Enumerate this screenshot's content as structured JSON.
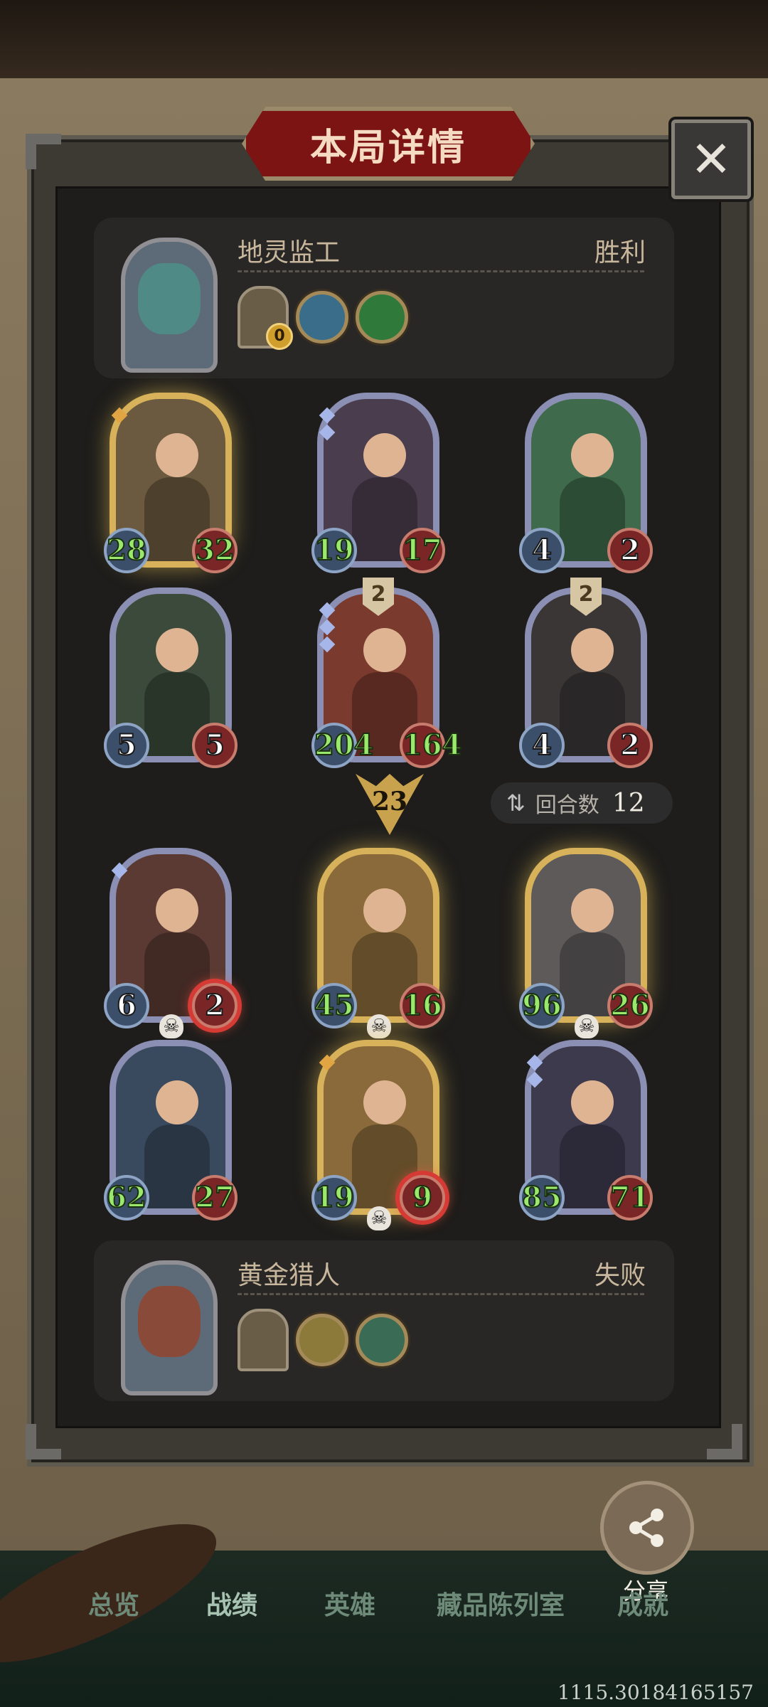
{
  "title": "本局详情",
  "close_symbol": "✕",
  "player_top": {
    "name": "地灵监工",
    "result": "胜利",
    "chest_count": "0",
    "relic_colors": [
      "#3a6d8a",
      "#2f7a3b"
    ]
  },
  "player_bottom": {
    "name": "黄金猎人",
    "result": "失败",
    "relic_colors": [
      "#8c7a3a",
      "#3a6b55"
    ]
  },
  "top_board": [
    {
      "attack": "28",
      "health": "32",
      "rarity": "gold",
      "art": "#6b5a3f",
      "tier": "",
      "stat_color": "green",
      "hit": false,
      "dead": false,
      "gems": 1,
      "gem_color": "gold"
    },
    {
      "attack": "19",
      "health": "17",
      "rarity": "silver",
      "art": "#4a3e4e",
      "tier": "",
      "stat_color": "green",
      "hit": false,
      "dead": false,
      "gems": 2,
      "gem_color": "silver"
    },
    {
      "attack": "4",
      "health": "2",
      "rarity": "silver",
      "art": "#3f6a4c",
      "tier": "",
      "stat_color": "white",
      "hit": false,
      "dead": false,
      "gems": 0,
      "gem_color": "silver"
    },
    {
      "attack": "5",
      "health": "5",
      "rarity": "silver",
      "art": "#3b4a3a",
      "tier": "",
      "stat_color": "white",
      "hit": false,
      "dead": false,
      "gems": 0,
      "gem_color": "silver"
    },
    {
      "attack": "204",
      "health": "164",
      "rarity": "silver",
      "art": "#7b3a2e",
      "tier": "2",
      "stat_color": "green",
      "hit": false,
      "dead": false,
      "gems": 3,
      "gem_color": "silver"
    },
    {
      "attack": "4",
      "health": "2",
      "rarity": "silver",
      "art": "#3a3636",
      "tier": "2",
      "stat_color": "white",
      "hit": false,
      "dead": false,
      "gems": 0,
      "gem_color": "silver"
    }
  ],
  "round_marker": "23",
  "rounds": {
    "icon": "⇅",
    "label": "回合数",
    "value": "12"
  },
  "bottom_board": [
    {
      "attack": "6",
      "health": "2",
      "rarity": "silver",
      "art": "#5a3a32",
      "tier": "",
      "stat_color": "white",
      "hit": true,
      "dead": true,
      "gems": 1,
      "gem_color": "silver"
    },
    {
      "attack": "45",
      "health": "16",
      "rarity": "gold",
      "art": "#8a6a3a",
      "tier": "",
      "stat_color": "green",
      "hit": false,
      "dead": true,
      "gems": 0,
      "gem_color": "silver"
    },
    {
      "attack": "96",
      "health": "26",
      "rarity": "gold",
      "art": "#5e5a5a",
      "tier": "",
      "stat_color": "green",
      "hit": false,
      "dead": true,
      "gems": 0,
      "gem_color": "silver"
    },
    {
      "attack": "62",
      "health": "27",
      "rarity": "silver",
      "art": "#3a4a5e",
      "tier": "",
      "stat_color": "green",
      "hit": false,
      "dead": false,
      "gems": 0,
      "gem_color": "silver"
    },
    {
      "attack": "19",
      "health": "9",
      "rarity": "gold",
      "art": "#8a6a3a",
      "tier": "",
      "stat_color": "green",
      "hit": true,
      "dead": true,
      "gems": 1,
      "gem_color": "gold"
    },
    {
      "attack": "85",
      "health": "71",
      "rarity": "silver",
      "art": "#3e3a4e",
      "tier": "",
      "stat_color": "green",
      "hit": false,
      "dead": false,
      "gems": 2,
      "gem_color": "silver"
    }
  ],
  "share": {
    "icon": "⟨",
    "label": "分享"
  },
  "tabs": [
    "总览",
    "战绩",
    "英雄",
    "藏品陈列室",
    "成就"
  ],
  "active_tab": 1,
  "version": "1115.30184165157"
}
